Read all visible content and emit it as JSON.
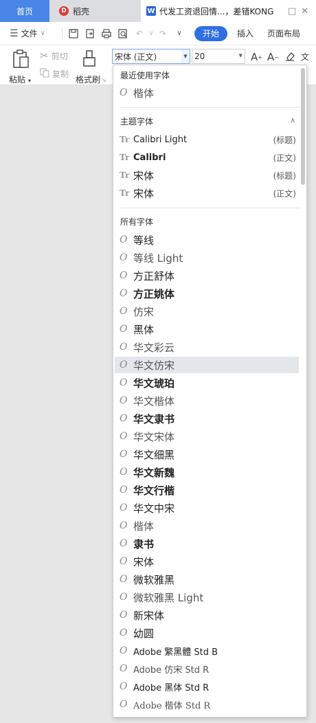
{
  "tabs": {
    "home": "首页",
    "docer": "稻壳",
    "doc_title": "代发工资退回情...，差错KONG"
  },
  "menu": {
    "file": "文件",
    "start": "开始",
    "insert": "插入",
    "layout": "页面布局"
  },
  "ribbon": {
    "paste": "粘贴",
    "cut": "剪切",
    "copy": "复制",
    "format_painter": "格式刷",
    "font_value": "宋体 (正文)",
    "size_value": "20"
  },
  "dropdown": {
    "recent_title": "最近使用字体",
    "recent_fonts": [
      "楷体"
    ],
    "theme_title": "主题字体",
    "theme_fonts": [
      {
        "name": "Calibri Light",
        "role": "(标题)"
      },
      {
        "name": "Calibri",
        "role": "(正文)"
      },
      {
        "name": "宋体",
        "role": "(标题)"
      },
      {
        "name": "宋体",
        "role": "(正文)"
      }
    ],
    "all_title": "所有字体",
    "all_fonts": [
      "等线",
      "等线 Light",
      "方正舒体",
      "方正姚体",
      "仿宋",
      "黑体",
      "华文彩云",
      "华文仿宋",
      "华文琥珀",
      "华文楷体",
      "华文隶书",
      "华文宋体",
      "华文细黑",
      "华文新魏",
      "华文行楷",
      "华文中宋",
      "楷体",
      "隶书",
      "宋体",
      "微软雅黑",
      "微软雅黑 Light",
      "新宋体",
      "幼圆",
      "Adobe 繁黑體 Std B",
      "Adobe 仿宋 Std R",
      "Adobe 黑体 Std R",
      "Adobe 楷体 Std R"
    ]
  }
}
